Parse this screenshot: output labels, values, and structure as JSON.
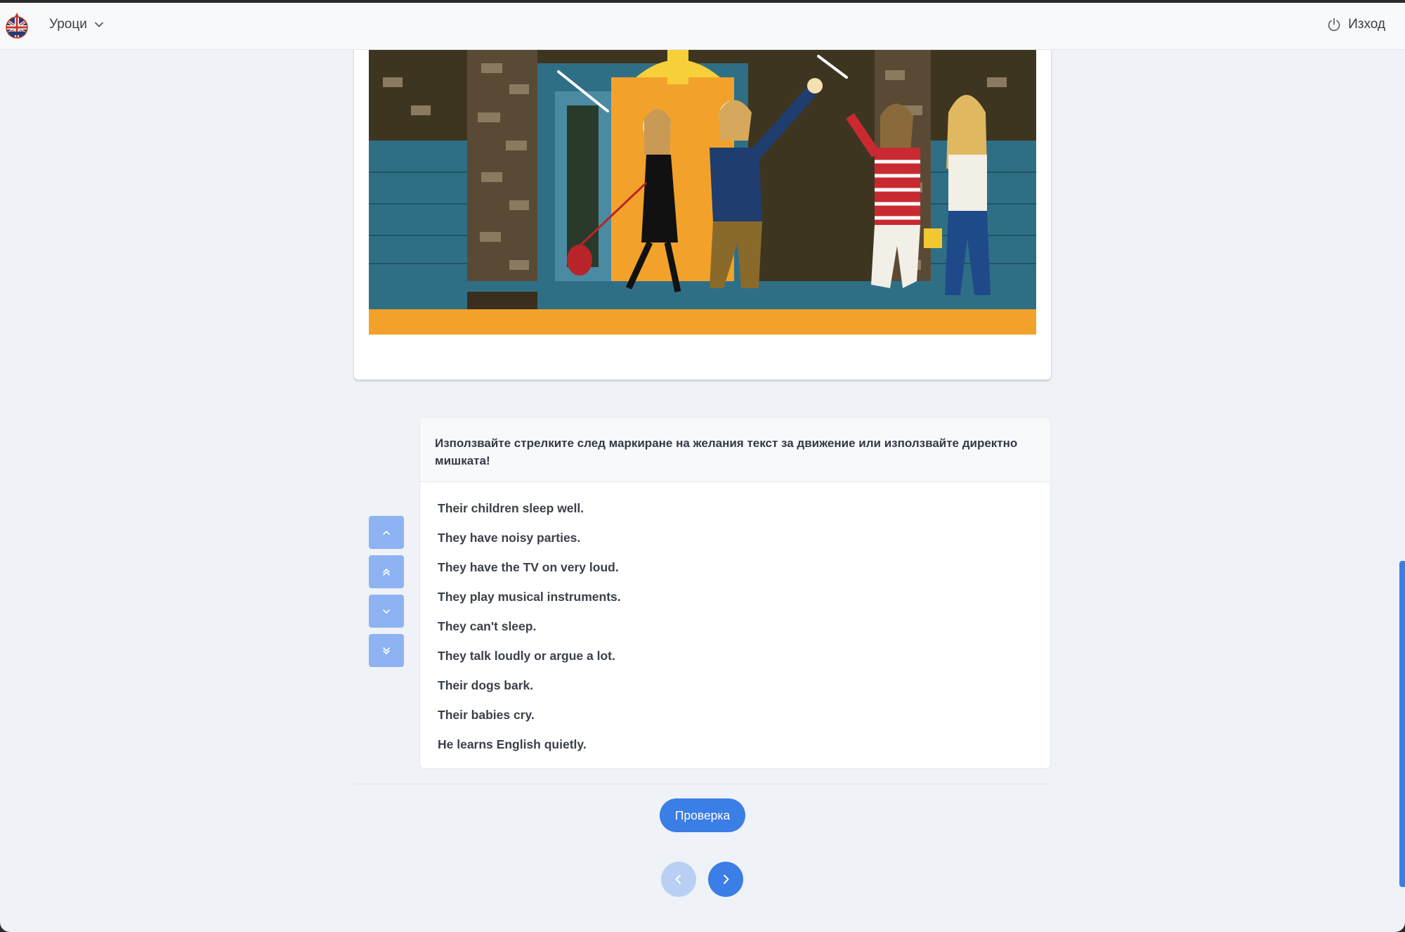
{
  "navbar": {
    "logo_icon": "union-jack-badge-icon",
    "menu_label": "Уроци",
    "logout_label": "Изход"
  },
  "illustration": {
    "description_icon": "neighbours-party-illustration"
  },
  "exercise": {
    "instruction": "Използвайте стрелките след маркиране на желания текст за движение или използвайте директно мишката!",
    "items": [
      "Their children sleep well.",
      "They have noisy parties.",
      "They have the TV on very loud.",
      "They play musical instruments.",
      "They can't sleep.",
      "They talk loudly or argue a lot.",
      "Their dogs bark.",
      "Their babies cry.",
      "He learns English quietly."
    ],
    "move_buttons": [
      "chevron-up-icon",
      "chevrons-up-icon",
      "chevron-down-icon",
      "chevrons-down-icon"
    ]
  },
  "actions": {
    "check_label": "Проверка",
    "prev_icon": "chevron-left-icon",
    "next_icon": "chevron-right-icon"
  },
  "colors": {
    "primary": "#3a7ee6",
    "primary_light": "#8db3f2",
    "page_bg": "#eff2f6"
  }
}
